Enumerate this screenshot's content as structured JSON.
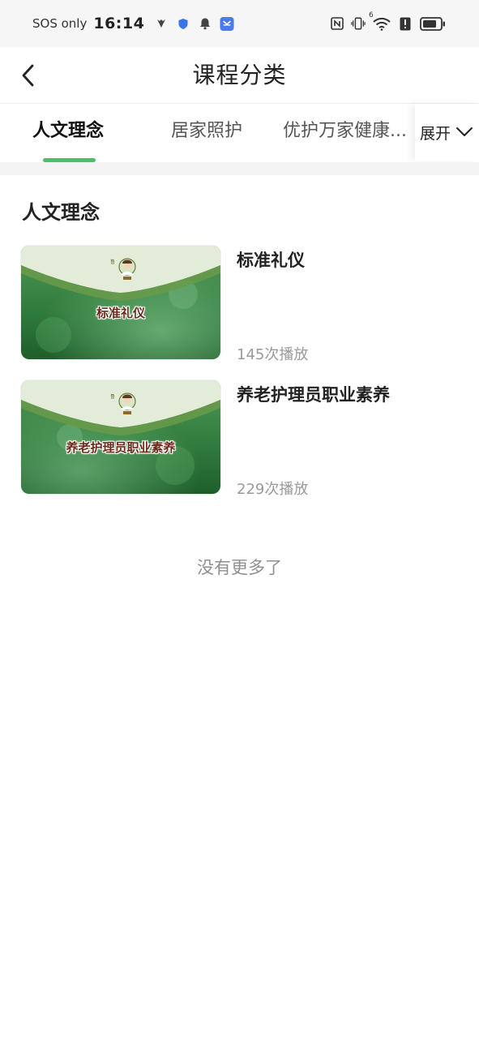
{
  "status_bar": {
    "carrier": "SOS only",
    "time": "16:14",
    "signal_label": "6"
  },
  "nav": {
    "title": "课程分类"
  },
  "tabs": [
    {
      "label": "人文理念",
      "active": true
    },
    {
      "label": "居家照护",
      "active": false
    },
    {
      "label": "优护万家健康...",
      "active": false
    }
  ],
  "expand_label": "展开",
  "section": {
    "title": "人文理念"
  },
  "courses": [
    {
      "title": "标准礼仪",
      "thumb_title": "标准礼仪",
      "plays": "145次播放"
    },
    {
      "title": "养老护理员职业素养",
      "thumb_title": "养老护理员职业素养",
      "plays": "229次播放"
    }
  ],
  "footer": {
    "no_more": "没有更多了"
  },
  "colors": {
    "accent": "#4cbf6a",
    "thumb_green_dark": "#2f7a3c",
    "thumb_green_light": "#d9e8cf"
  }
}
